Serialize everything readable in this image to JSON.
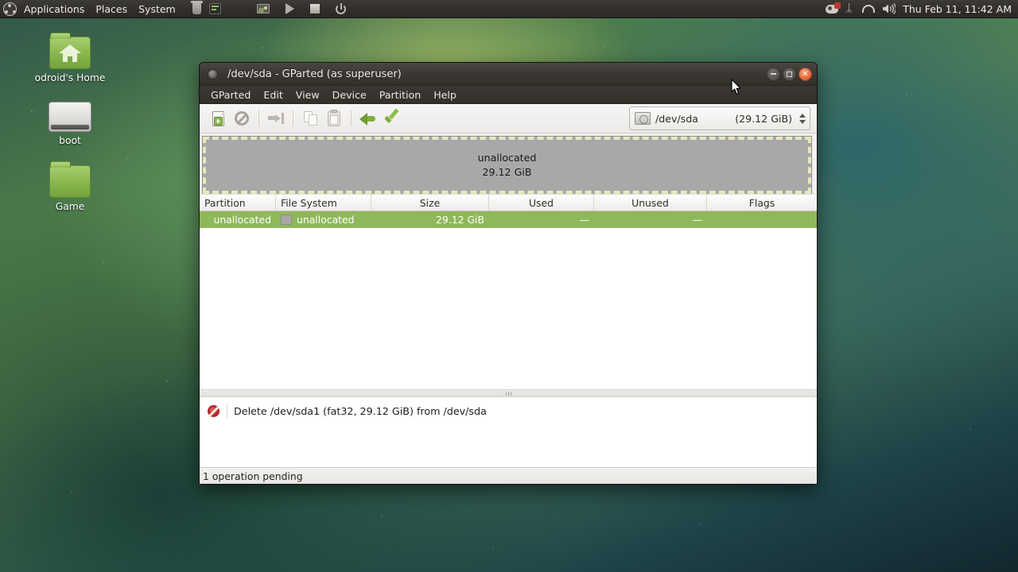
{
  "panel": {
    "logo_icon": "ubuntu-logo-icon",
    "menus": [
      "Applications",
      "Places",
      "System"
    ],
    "launchers": [
      {
        "name": "trash-icon",
        "label": "Trash"
      },
      {
        "name": "terminal-icon",
        "label": "Terminal"
      }
    ],
    "media_controls": [
      {
        "name": "image-viewer-icon",
        "label": "Image Viewer"
      },
      {
        "name": "play-icon",
        "label": "Play"
      },
      {
        "name": "stop-icon",
        "label": "Stop"
      },
      {
        "name": "power-icon",
        "label": "Power"
      }
    ],
    "tray": [
      {
        "name": "input-device-icon",
        "label": "Input device"
      },
      {
        "name": "bluetooth-icon",
        "label": "Bluetooth",
        "glyph": "ᛦ"
      },
      {
        "name": "wifi-icon",
        "label": "Network"
      },
      {
        "name": "volume-icon",
        "label": "Volume"
      }
    ],
    "clock": "Thu Feb 11, 11:42 AM"
  },
  "desktop": {
    "icons": [
      {
        "name": "odroid-home",
        "label": "odroid's Home",
        "type": "home-folder"
      },
      {
        "name": "boot",
        "label": "boot",
        "type": "drive"
      },
      {
        "name": "game",
        "label": "Game",
        "type": "folder"
      }
    ]
  },
  "window": {
    "title": "/dev/sda - GParted (as superuser)",
    "menus": [
      "GParted",
      "Edit",
      "View",
      "Device",
      "Partition",
      "Help"
    ],
    "controls": {
      "minimize": "–",
      "maximize": "□",
      "close": "✕"
    },
    "toolbar": [
      {
        "name": "new-partition-button",
        "label": "New",
        "enabled": true
      },
      {
        "name": "delete-partition-button",
        "label": "Delete",
        "enabled": true
      },
      {
        "name": "resize-move-button",
        "label": "Resize/Move",
        "enabled": false
      },
      {
        "name": "copy-button",
        "label": "Copy",
        "enabled": false
      },
      {
        "name": "paste-button",
        "label": "Paste",
        "enabled": false
      },
      {
        "name": "undo-button",
        "label": "Undo",
        "enabled": true
      },
      {
        "name": "apply-button",
        "label": "Apply All Operations",
        "enabled": true
      }
    ],
    "device_selector": {
      "icon": "hard-disk-icon",
      "device": "/dev/sda",
      "size": "(29.12 GiB)"
    },
    "disk_graphic": {
      "partition_label": "unallocated",
      "partition_size": "29.12 GiB",
      "fill_color": "#a8a8a8",
      "border_color": "#e8e8c0"
    },
    "table": {
      "headers": [
        "Partition",
        "File System",
        "Size",
        "Used",
        "Unused",
        "Flags"
      ],
      "rows": [
        {
          "partition": "unallocated",
          "filesystem": "unallocated",
          "filesystem_color": "#a8a8a8",
          "size": "29.12 GiB",
          "used": "—",
          "unused": "—",
          "flags": "",
          "selected": true,
          "selection_color": "#8fb85a"
        }
      ]
    },
    "operations": [
      {
        "icon": "delete-operation-icon",
        "text": "Delete /dev/sda1 (fat32, 29.12 GiB) from /dev/sda"
      }
    ],
    "statusbar": "1 operation pending"
  }
}
